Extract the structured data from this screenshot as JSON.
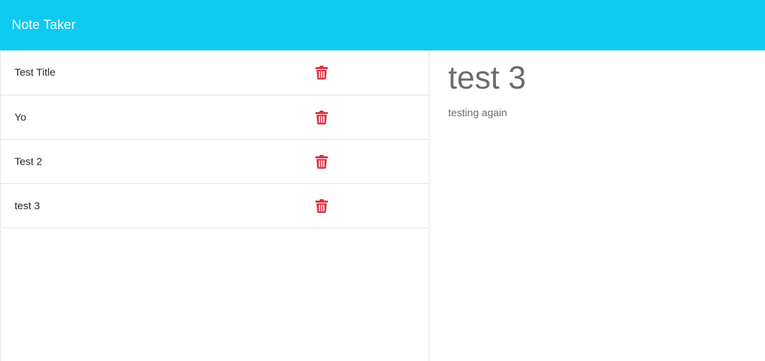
{
  "navbar": {
    "brand": "Note Taker",
    "background_color": "#0dcaf0"
  },
  "notes": [
    {
      "title": "Test Title",
      "delete_icon": "trash-icon"
    },
    {
      "title": "Yo",
      "delete_icon": "trash-icon"
    },
    {
      "title": "Test 2",
      "delete_icon": "trash-icon"
    },
    {
      "title": "test 3",
      "delete_icon": "trash-icon"
    }
  ],
  "active_note": {
    "title": "test 3",
    "text": "testing again"
  },
  "colors": {
    "delete": "#dc3545",
    "text": "#212529",
    "muted_text": "#6c6c6c",
    "border": "#dee2e6"
  }
}
